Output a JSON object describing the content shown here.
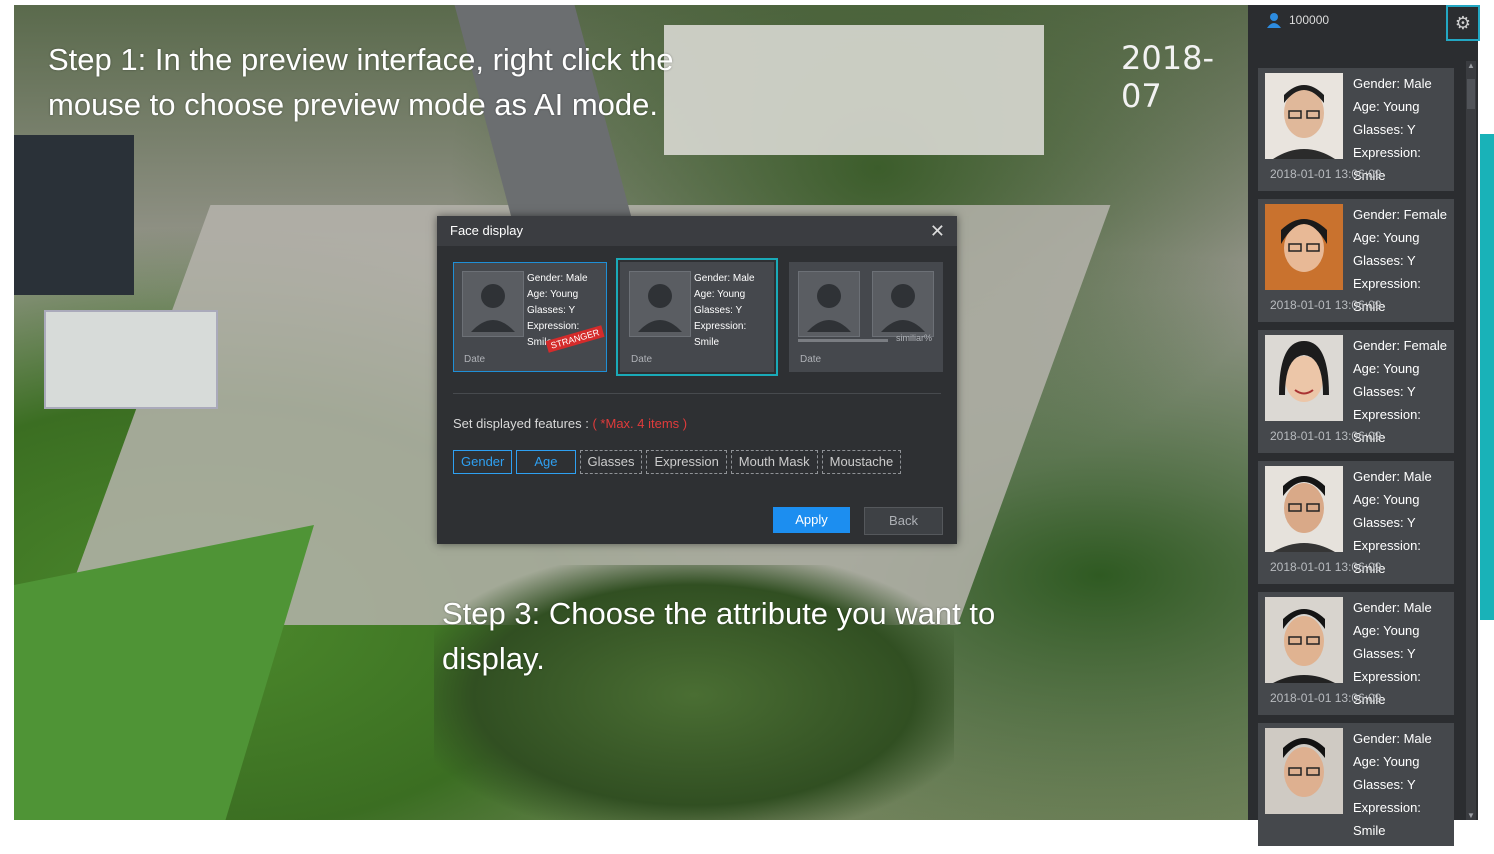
{
  "scene": {
    "clock": "2018-07",
    "step1": "Step 1: In the preview interface, right click the mouse to choose preview mode as AI mode.",
    "step3": "Step 3: Choose the attribute you want to display."
  },
  "dialog": {
    "title": "Face display",
    "close": "✕",
    "cards": [
      {
        "attrs": [
          "Gender: Male",
          "Age: Young",
          "Glasses: Y",
          "Expression: Smile"
        ],
        "date": "Date",
        "badge": "STRANGER"
      },
      {
        "attrs": [
          "Gender: Male",
          "Age: Young",
          "Glasses: Y",
          "Expression: Smile"
        ],
        "date": "Date"
      },
      {
        "date": "Date",
        "similar": "similiar%"
      }
    ],
    "features_label": "Set displayed features :",
    "features_max": "( *Max. 4 items )",
    "features": [
      {
        "label": "Gender",
        "selected": true
      },
      {
        "label": "Age",
        "selected": true
      },
      {
        "label": "Glasses",
        "selected": false
      },
      {
        "label": "Expression",
        "selected": false
      },
      {
        "label": "Mouth Mask",
        "selected": false
      },
      {
        "label": "Moustache",
        "selected": false
      }
    ],
    "apply": "Apply",
    "back": "Back"
  },
  "panel": {
    "user_id": "100000",
    "faces": [
      {
        "gender": "Gender: Male",
        "age": "Age: Young",
        "glasses": "Glasses: Y",
        "expression": "Expression: Smile",
        "date": "2018-01-01  13:06:09"
      },
      {
        "gender": "Gender: Female",
        "age": "Age: Young",
        "glasses": "Glasses: Y",
        "expression": "Expression: Smile",
        "date": "2018-01-01  13:06:09"
      },
      {
        "gender": "Gender: Female",
        "age": "Age: Young",
        "glasses": "Glasses: Y",
        "expression": "Expression: Smile",
        "date": "2018-01-01  13:06:09"
      },
      {
        "gender": "Gender: Male",
        "age": "Age: Young",
        "glasses": "Glasses: Y",
        "expression": "Expression: Smile",
        "date": "2018-01-01  13:06:09"
      },
      {
        "gender": "Gender: Male",
        "age": "Age: Young",
        "glasses": "Glasses: Y",
        "expression": "Expression: Smile",
        "date": "2018-01-01  13:06:09"
      },
      {
        "gender": "Gender: Male",
        "age": "Age: Young",
        "glasses": "Glasses: Y",
        "expression": "Expression: Smile",
        "date": ""
      }
    ]
  },
  "colors": {
    "accent": "#1c8ef0",
    "highlight": "#1aaab8",
    "warning": "#e03b3b"
  }
}
